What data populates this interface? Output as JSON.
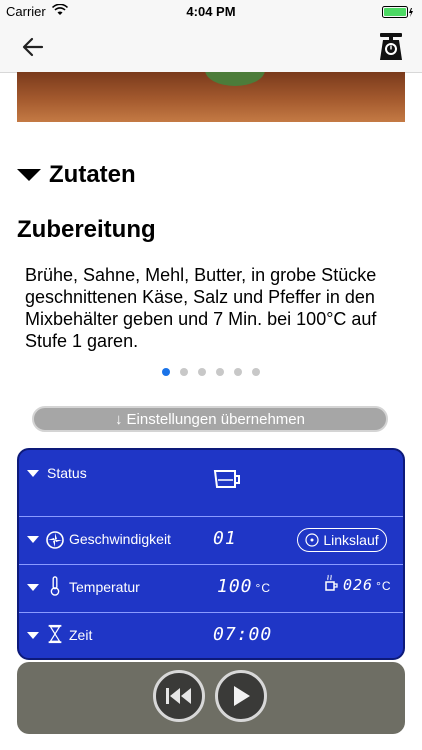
{
  "status_bar": {
    "carrier": "Carrier",
    "time": "4:04 PM"
  },
  "nav": {
    "back_icon": "arrow-left-icon",
    "scale_icon": "kitchen-scale-icon"
  },
  "recipe": {
    "collapsed_section": "Zutaten",
    "section_title": "Zubereitung",
    "instruction_text": "Brühe, Sahne, Mehl, Butter, in grobe Stücke geschnittenen Käse, Salz und Pfeffer in den Mixbehälter geben und 7 Min. bei 100°C auf Stufe 1 garen.",
    "pager": {
      "total": 6,
      "active_index": 0
    }
  },
  "apply_button": {
    "label": "Einstellungen übernehmen"
  },
  "device_panel": {
    "status": {
      "label": "Status"
    },
    "speed": {
      "label": "Geschwindigkeit",
      "value": "01",
      "reverse_label": "Linkslauf"
    },
    "temperature": {
      "label": "Temperatur",
      "value": "100",
      "unit": "°C",
      "current_value": "026",
      "current_unit": "°C"
    },
    "time": {
      "label": "Zeit",
      "value": "07:00"
    }
  },
  "playback": {
    "prev_icon": "skip-back-icon",
    "play_icon": "play-icon"
  },
  "colors": {
    "panel_blue": "#1f36c6",
    "active_dot": "#1a73e8",
    "controls_bg": "#6e6e64"
  }
}
